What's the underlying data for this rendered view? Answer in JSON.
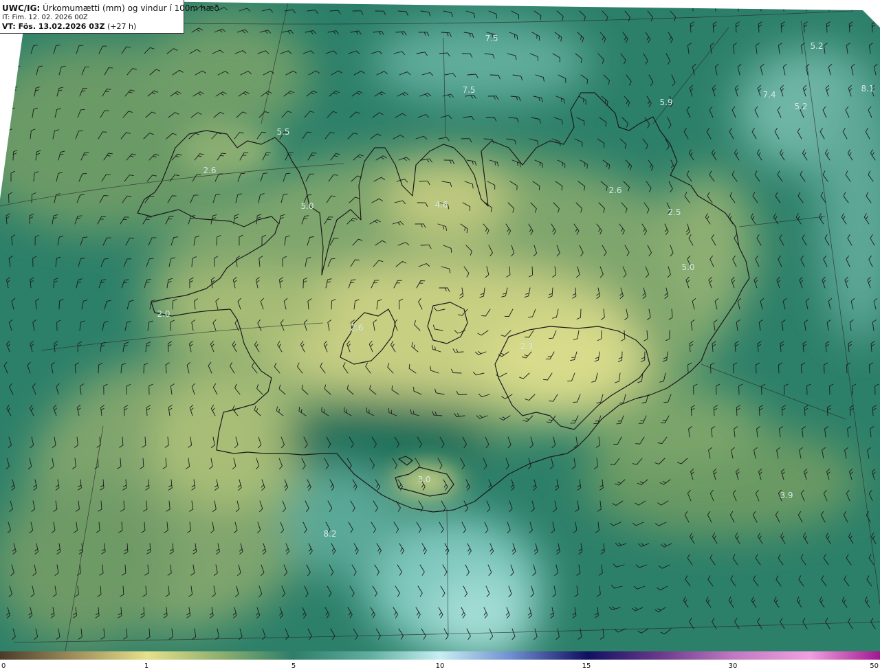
{
  "header": {
    "code": "UWC/IG:",
    "title": "Úrkomumætti (mm) og vindur í 100m hæð",
    "init": "IT: Fim. 12. 02. 2026 00Z",
    "valid_bold": "VT: Fös. 13.02.2026 03Z",
    "valid_lead": "(+27 h)"
  },
  "map_values": [
    "7.5",
    "5.2",
    "7.5",
    "7.4",
    "5.2",
    "8.1",
    "5.9",
    "5.5",
    "2.6",
    "2.6",
    "5.0",
    "4.6",
    "2.5",
    "5.0",
    "2.0",
    "2.6",
    "2.3",
    "3.0",
    "3.9",
    "8.2"
  ],
  "colorbar": {
    "ticks": [
      "0",
      "1",
      "5",
      "10",
      "15",
      "30",
      "50"
    ]
  },
  "colors": {
    "ocean_dark": "#1f6e5b",
    "ocean_mid": "#3a8e7a",
    "land_olive": "#7fa870",
    "land_yellow": "#d9dd8a",
    "cyan_light": "#9fdcd6",
    "coast": "#1a1a1a"
  }
}
